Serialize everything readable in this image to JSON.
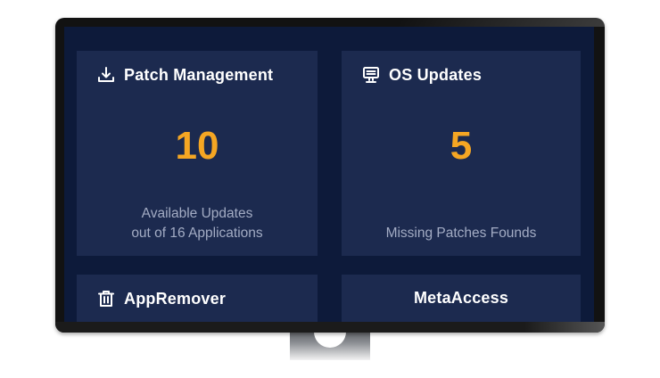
{
  "cards": {
    "patch": {
      "title": "Patch Management",
      "icon": "download-icon",
      "value": "10",
      "subtitle_line1": "Available Updates",
      "subtitle_line2": "out of 16 Applications"
    },
    "os": {
      "title": "OS Updates",
      "icon": "server-icon",
      "value": "5",
      "subtitle": "Missing Patches Founds"
    },
    "appremover": {
      "title": "AppRemover",
      "icon": "trash-icon"
    },
    "metaaccess": {
      "title": "MetaAccess"
    }
  },
  "colors": {
    "screen_bg": "#0d1a3a",
    "card_bg": "#1c2a4f",
    "accent": "#f5a623",
    "muted_text": "#a3acc4"
  }
}
